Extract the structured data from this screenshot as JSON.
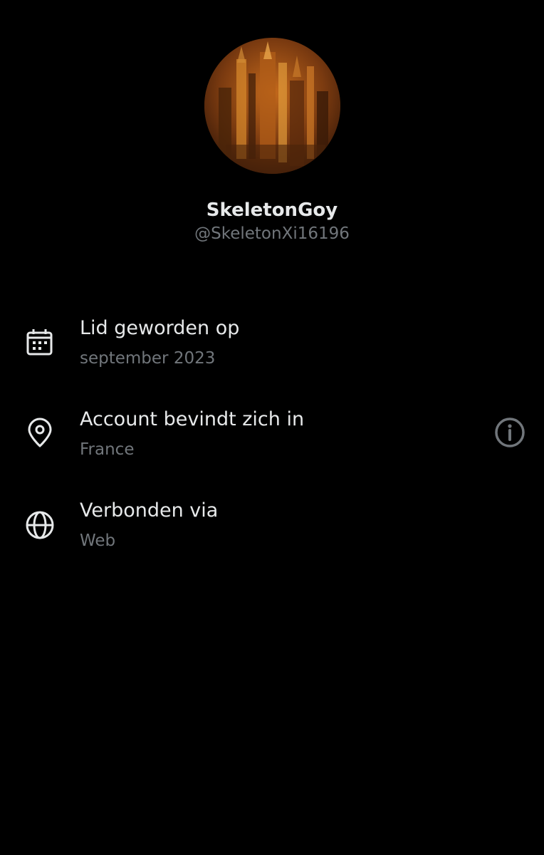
{
  "profile": {
    "display_name": "SkeletonGoy",
    "handle": "@SkeletonXi16196",
    "avatar_icon": "profile-picture"
  },
  "about": {
    "items": [
      {
        "icon": "calendar-icon",
        "title": "Lid geworden op",
        "value": "september 2023"
      },
      {
        "icon": "location-pin-icon",
        "title": "Account bevindt zich in",
        "value": "France"
      },
      {
        "icon": "globe-icon",
        "title": "Verbonden via",
        "value": "Web"
      }
    ],
    "info_icon": "info-icon"
  },
  "colors": {
    "background": "#000000",
    "primary_text": "#e7e9ea",
    "secondary_text": "#71767b"
  }
}
